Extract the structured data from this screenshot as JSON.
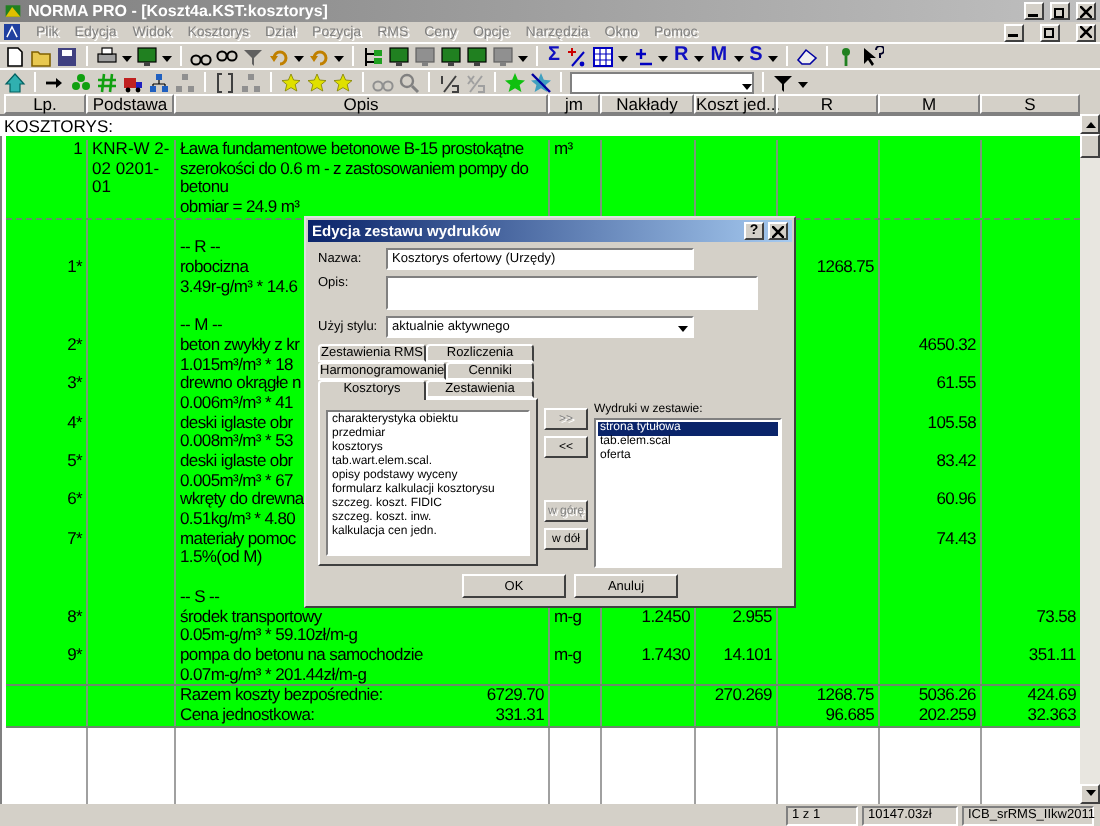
{
  "window": {
    "title": "NORMA PRO - [Koszt4a.KST:kosztorys]"
  },
  "menu": [
    {
      "label": "Plik",
      "disabled": true
    },
    {
      "label": "Edycja",
      "disabled": true
    },
    {
      "label": "Widok",
      "disabled": true
    },
    {
      "label": "Kosztorys",
      "disabled": true
    },
    {
      "label": "Dział",
      "disabled": true
    },
    {
      "label": "Pozycja",
      "disabled": true
    },
    {
      "label": "RMS",
      "disabled": true
    },
    {
      "label": "Ceny",
      "disabled": true
    },
    {
      "label": "Opcje",
      "disabled": true
    },
    {
      "label": "Narzędzia",
      "disabled": true
    },
    {
      "label": "Okno",
      "disabled": true
    },
    {
      "label": "Pomoc",
      "disabled": true
    }
  ],
  "toolbar_1": {
    "glyphs": [
      "Σ",
      "R",
      "M",
      "S"
    ]
  },
  "table": {
    "columns": [
      "Lp.",
      "Podstawa",
      "Opis",
      "jm",
      "Nakłady",
      "Koszt jed...",
      "R",
      "M",
      "S"
    ],
    "title": "KOSZTORYS:",
    "blocks": [
      {
        "podstawa": "KNR-W 2-02 0201-01",
        "lines": [
          {
            "kind": "text",
            "lp": "1",
            "opis": "Ława fundamentowe betonowe B-15 prostokątne",
            "jm": "m³"
          },
          {
            "kind": "text",
            "opis": "szerokości do 0.6 m - z zastosowaniem pompy do"
          },
          {
            "kind": "text",
            "opis": "betonu"
          },
          {
            "kind": "text",
            "opis": "obmiar  = 24.9 m³"
          }
        ]
      },
      {
        "lines": [
          {
            "kind": "blank"
          },
          {
            "kind": "text",
            "opis": "-- R --"
          },
          {
            "kind": "text",
            "lp": "1*",
            "opis": "robocizna",
            "r": "1268.75"
          },
          {
            "kind": "text",
            "opis": "3.49r-g/m³ * 14.6"
          },
          {
            "kind": "blank"
          },
          {
            "kind": "text",
            "opis": "-- M --"
          },
          {
            "kind": "text",
            "lp": "2*",
            "opis": "beton zwykły z kr",
            "m": "4650.32"
          },
          {
            "kind": "text",
            "opis": "1.015m³/m³ * 18"
          },
          {
            "kind": "text",
            "lp": "3*",
            "opis": "drewno okrągłe n",
            "m": "61.55"
          },
          {
            "kind": "text",
            "opis": "0.006m³/m³ * 41"
          },
          {
            "kind": "text",
            "lp": "4*",
            "opis": "deski iglaste obr",
            "m": "105.58"
          },
          {
            "kind": "text",
            "opis": "0.008m³/m³ * 53"
          },
          {
            "kind": "text",
            "lp": "5*",
            "opis": "deski iglaste obr",
            "m": "83.42"
          },
          {
            "kind": "text",
            "opis": "0.005m³/m³ * 67"
          },
          {
            "kind": "text",
            "lp": "6*",
            "opis": "wkręty do drewna",
            "m": "60.96"
          },
          {
            "kind": "text",
            "opis": "0.51kg/m³ * 4.80"
          },
          {
            "kind": "text",
            "lp": "7*",
            "opis": "materiały pomoc",
            "m": "74.43"
          },
          {
            "kind": "text",
            "opis": "1.5%(od M)"
          },
          {
            "kind": "blank"
          },
          {
            "kind": "text",
            "opis": "-- S --"
          },
          {
            "kind": "text",
            "lp": "8*",
            "opis": "środek transportowy",
            "jm": "m-g",
            "naklady": "1.2450",
            "koszt": "2.955",
            "s": "73.58"
          },
          {
            "kind": "text",
            "opis": "0.05m-g/m³ * 59.10zł/m-g"
          },
          {
            "kind": "text",
            "lp": "9*",
            "opis": "pompa do betonu na samochodzie",
            "jm": "m-g",
            "naklady": "1.7430",
            "koszt": "14.101",
            "s": "351.11"
          },
          {
            "kind": "text",
            "opis": "0.07m-g/m³ * 201.44zł/m-g"
          }
        ]
      },
      {
        "lines": [
          {
            "kind": "text",
            "opis": "Razem koszty bezpośrednie:",
            "total": "6729.70",
            "koszt": "270.269",
            "r": "1268.75",
            "m": "5036.26",
            "s": "424.69"
          },
          {
            "kind": "text",
            "opis": "Cena jednostkowa:",
            "total": "331.31",
            "r": "96.685",
            "m": "202.259",
            "s": "32.363"
          }
        ]
      }
    ]
  },
  "dialog": {
    "title": "Edycja zestawu wydruków",
    "help": "?",
    "name_label": "Nazwa:",
    "name_value": "Kosztorys ofertowy (Urzędy)",
    "desc_label": "Opis:",
    "style_label": "Użyj stylu:",
    "style_value": "aktualnie aktywnego",
    "tab_rows": [
      [
        {
          "label": "Zestawienia RMS",
          "selected": false
        },
        {
          "label": "Rozliczenia",
          "selected": false
        }
      ],
      [
        {
          "label": "Harmonogramowanie",
          "selected": false
        },
        {
          "label": "Cenniki",
          "selected": false
        }
      ],
      [
        {
          "label": "Kosztorys",
          "selected": true
        },
        {
          "label": "Zestawienia",
          "selected": false
        }
      ]
    ],
    "available": [
      {
        "label": "charakterystyka obiektu",
        "selected": false
      },
      {
        "label": "przedmiar",
        "selected": false
      },
      {
        "label": "kosztorys",
        "selected": false
      },
      {
        "label": "tab.wart.elem.scal.",
        "selected": false
      },
      {
        "label": "opisy podstawy wyceny",
        "selected": false
      },
      {
        "label": "formularz kalkulacji kosztorysu",
        "selected": false
      },
      {
        "label": "szczeg. koszt. FIDIC",
        "selected": false
      },
      {
        "label": "szczeg. koszt. inw.",
        "selected": false
      },
      {
        "label": "kalkulacja cen jedn.",
        "selected": false
      }
    ],
    "move_buttons": [
      {
        "label": ">>",
        "disabled": true
      },
      {
        "label": "<<",
        "disabled": false
      },
      {
        "label": "w górę",
        "disabled": true
      },
      {
        "label": "w dół",
        "disabled": false
      }
    ],
    "chosen_label": "Wydruki w zestawie:",
    "chosen": [
      {
        "label": "strona tytułowa",
        "selected": true
      },
      {
        "label": "tab.elem.scal",
        "selected": false
      },
      {
        "label": "oferta",
        "selected": false
      }
    ],
    "buttons": [
      "OK",
      "Anuluj"
    ]
  },
  "status_bar": [
    "1 z 1",
    "10147.03zł",
    "ICB_srRMS_IIkw2011"
  ]
}
